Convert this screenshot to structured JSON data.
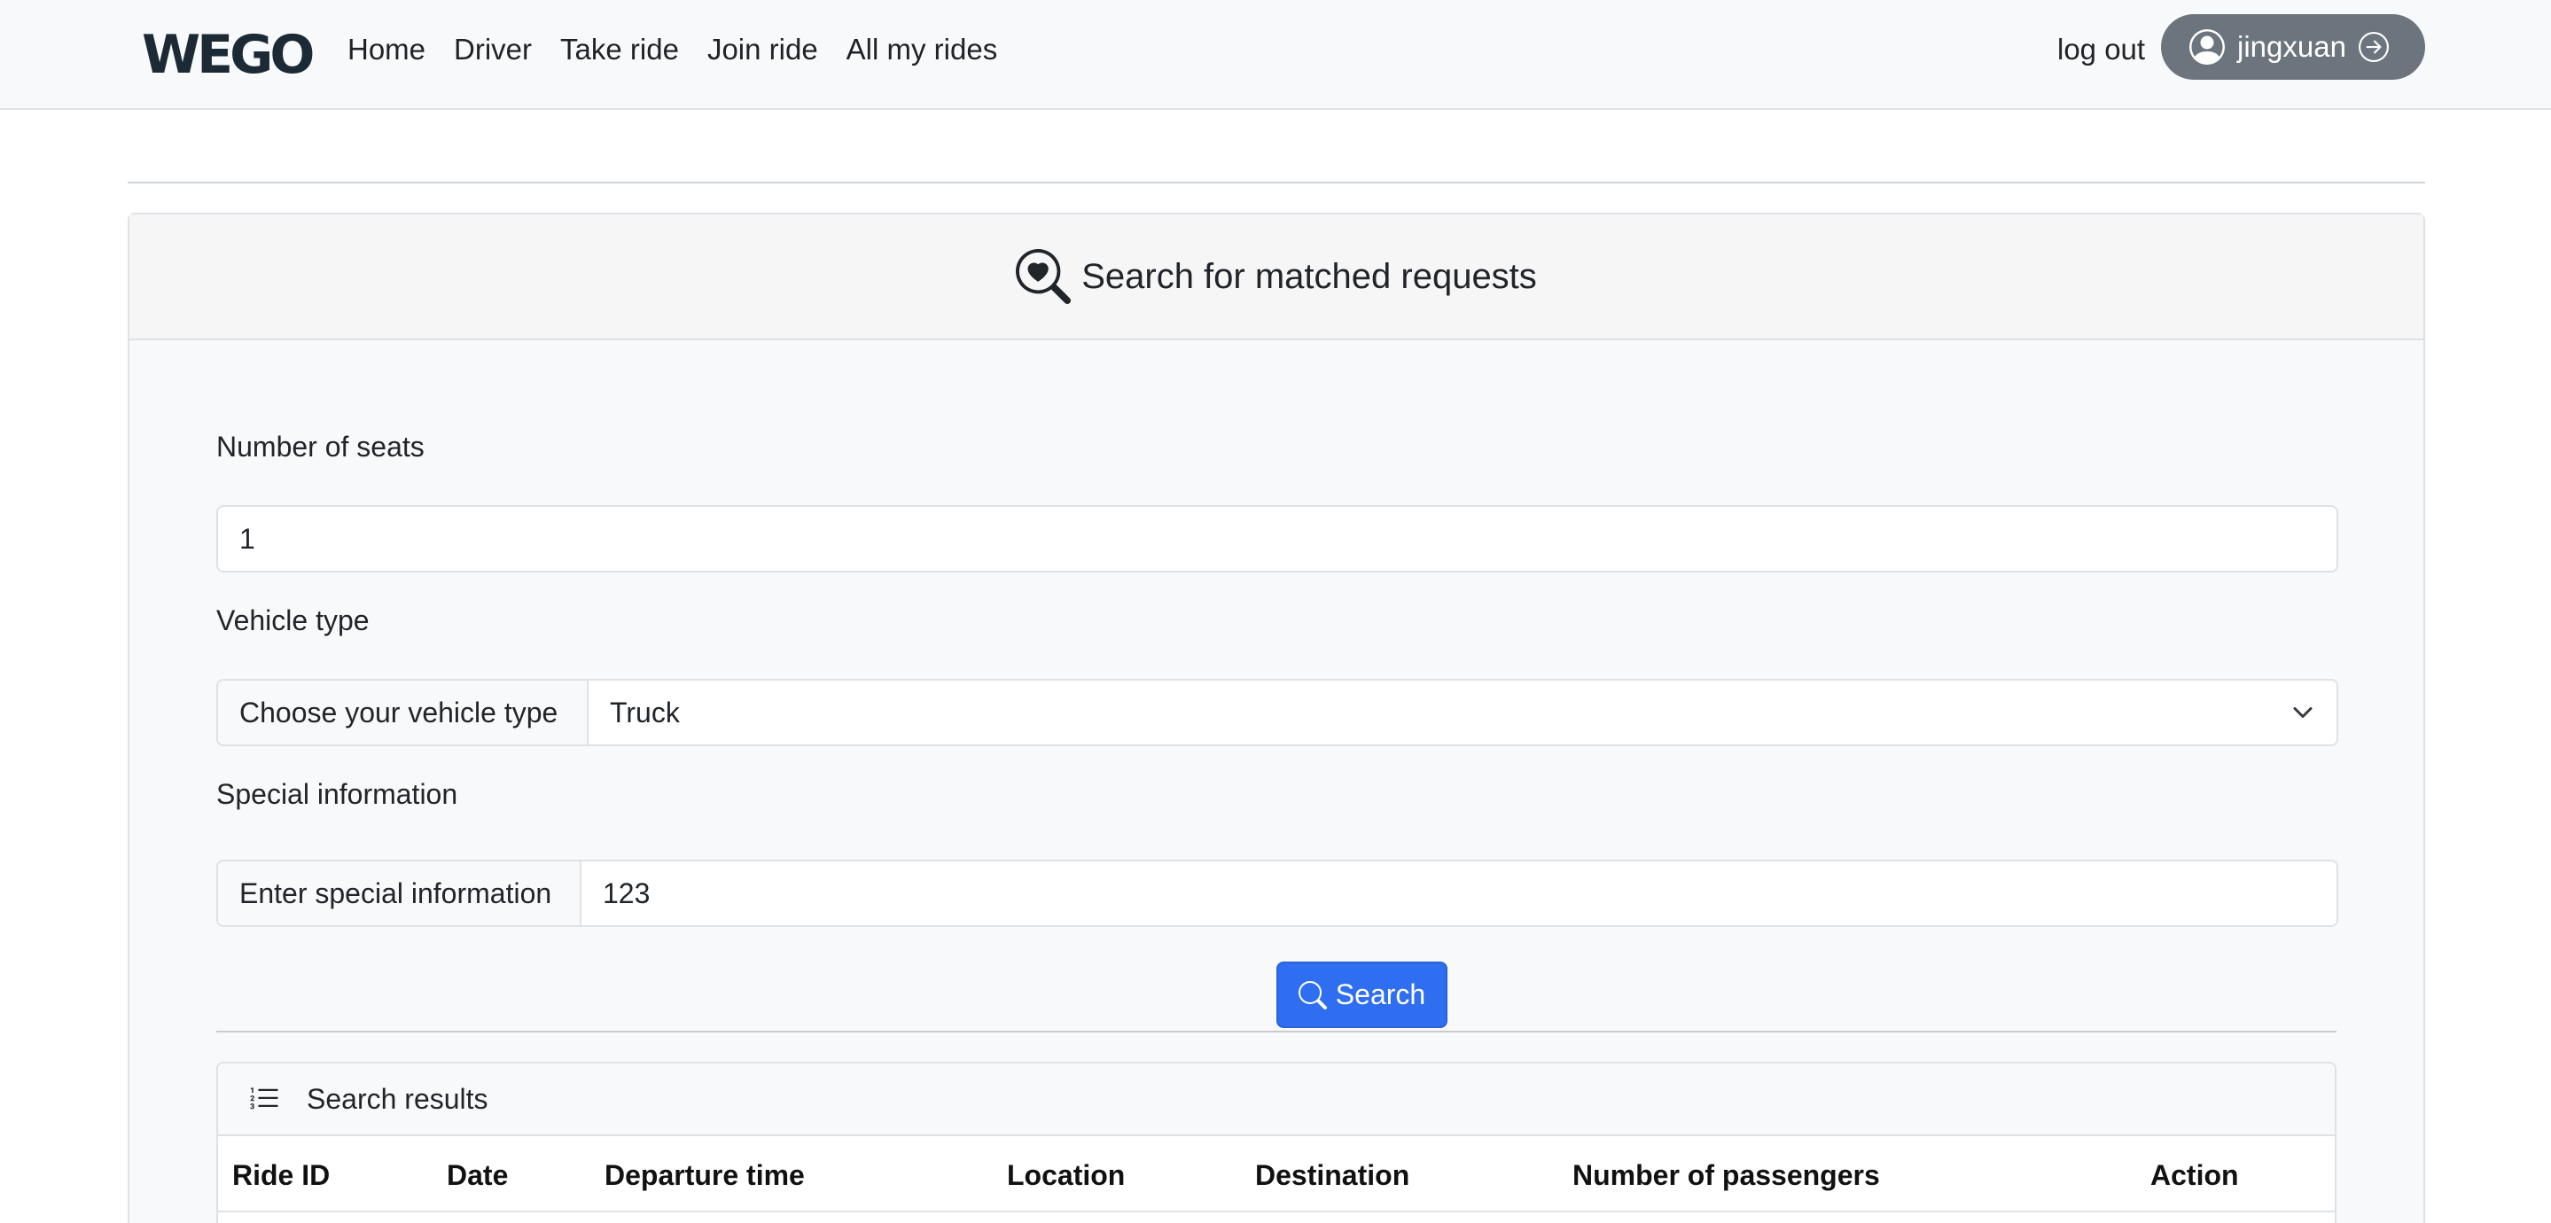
{
  "nav": {
    "brand": "WEGO",
    "links": [
      "Home",
      "Driver",
      "Take ride",
      "Join ride",
      "All my rides"
    ],
    "logout": "log out",
    "username": "jingxuan"
  },
  "card": {
    "title": "Search for matched requests",
    "seats": {
      "label": "Number of seats",
      "value": "1"
    },
    "vehicle": {
      "label": "Vehicle type",
      "prefix": "Choose your vehicle type",
      "selected": "Truck"
    },
    "special": {
      "label": "Special information",
      "prefix": "Enter special information",
      "value": "123"
    },
    "search_button": "Search"
  },
  "results": {
    "title": "Search results",
    "columns": [
      "Ride ID",
      "Date",
      "Departure time",
      "Location",
      "Destination",
      "Number of passengers",
      "Action"
    ]
  },
  "colors": {
    "primary": "#2f6ef0",
    "secondary": "#6c757d",
    "navbar_bg": "#f8f9fa"
  },
  "icons": [
    "search-heart-icon",
    "search-icon",
    "list-icon",
    "person-circle-icon",
    "arrow-right-circle-icon",
    "chevron-down-icon"
  ]
}
